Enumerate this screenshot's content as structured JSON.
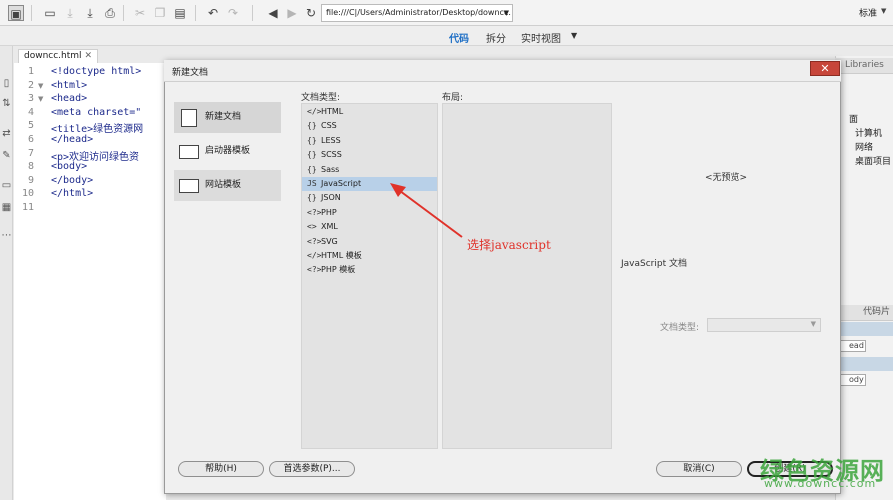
{
  "toolbar": {
    "url": "file:///C|/Users/Administrator/Desktop/downcc.",
    "standard_label": "标准",
    "icons": [
      "new-file-icon",
      "open-folder-icon",
      "save-icon",
      "save-all-icon",
      "print-icon",
      "cut-icon",
      "copy-icon",
      "paste-icon",
      "undo-icon",
      "redo-icon",
      "back-icon",
      "forward-icon",
      "refresh-icon"
    ]
  },
  "view_tabs": {
    "code": "代码",
    "split": "拆分",
    "live": "实时视图"
  },
  "file_tab": {
    "name": "downcc.html",
    "close": "✕"
  },
  "editor": {
    "line_numbers": [
      "1",
      "2",
      "3",
      "4",
      "5",
      "6",
      "7",
      "8",
      "9",
      "10",
      "11"
    ],
    "lines": [
      "<!doctype html>",
      "<html>",
      "<head>",
      "<meta charset=\"",
      "<title>绿色资源网",
      "</head>",
      "<p>欢迎访问绿色资",
      "<body>",
      "</body>",
      "</html>",
      ""
    ]
  },
  "right_panel": {
    "libraries_tab": "Libraries",
    "items": [
      "面",
      "计算机",
      "网络",
      "桌面项目"
    ],
    "snippets_tab": "代码片",
    "tags": [
      "ead",
      "ody"
    ]
  },
  "dialog": {
    "title": "新建文档",
    "close": "✕",
    "categories": [
      {
        "label": "新建文档",
        "selected": true
      },
      {
        "label": "启动器模板",
        "selected": false
      },
      {
        "label": "网站模板",
        "selected": false
      }
    ],
    "doc_type_header": "文档类型:",
    "layout_header": "布局:",
    "doc_types": [
      {
        "glyph": "</>",
        "label": "HTML"
      },
      {
        "glyph": "{}",
        "label": "CSS"
      },
      {
        "glyph": "{}",
        "label": "LESS"
      },
      {
        "glyph": "{}",
        "label": "SCSS"
      },
      {
        "glyph": "{}",
        "label": "Sass"
      },
      {
        "glyph": "JS",
        "label": "JavaScript"
      },
      {
        "glyph": "{}",
        "label": "JSON"
      },
      {
        "glyph": "<?>",
        "label": "PHP"
      },
      {
        "glyph": "<>",
        "label": "XML"
      },
      {
        "glyph": "<?>",
        "label": "SVG"
      },
      {
        "glyph": "</>",
        "label": "HTML 模板"
      },
      {
        "glyph": "<?>",
        "label": "PHP 模板"
      }
    ],
    "selected_doc_type": "JavaScript",
    "no_preview": "<无预览>",
    "description": "JavaScript 文档",
    "doctype_label": "文档类型:",
    "buttons": {
      "help": "帮助(H)",
      "preferences": "首选参数(P)...",
      "cancel": "取消(C)",
      "create": "创建(R)"
    }
  },
  "annotation": {
    "text": "选择javascript",
    "color": "#e0322a"
  },
  "watermark": {
    "name": "绿色资源网",
    "url": "www.downcc.com"
  }
}
